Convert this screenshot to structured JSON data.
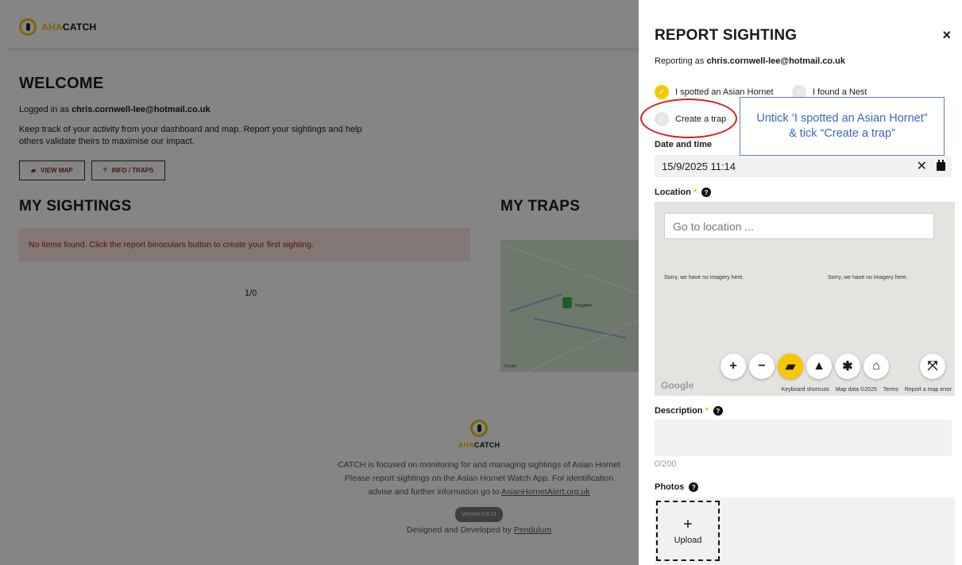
{
  "app": {
    "brand_aha": "AHA",
    "brand_catch": "CATCH"
  },
  "welcome": {
    "title": "WELCOME",
    "logged_prefix": "Logged in as ",
    "logged_email": "chris.cornwell-lee@hotmail.co.uk",
    "intro": "Keep track of your activity from your dashboard and map. Report your sightings and help others validate theirs to maximise our impact.",
    "view_map": "VIEW MAP",
    "info_traps": "INFO / TRAPS"
  },
  "sightings": {
    "title": "MY SIGHTINGS",
    "empty_message": "No items found. Click the report binoculars button to create your first sighting.",
    "pager": "1/0"
  },
  "traps": {
    "title": "MY TRAPS",
    "map_place": "Haughton",
    "map_attribution": "Google"
  },
  "footer": {
    "line1": "CATCH is focused on monitoring for and managing sightings of Asian Hornet",
    "line2": "Please report sightings on the Asian Hornet Watch App. For identification",
    "line3_prefix": "advise and further information go to ",
    "line3_link": "AsianHornetAlert.org.uk",
    "version": "Version 0.9.11",
    "designed_prefix": "Designed and Developed by ",
    "designed_link": "Pendulum"
  },
  "panel": {
    "title": "REPORT SIGHTING",
    "close": "×",
    "reporting_prefix": "Reporting as ",
    "reporting_email": "chris.cornwell-lee@hotmail.co.uk",
    "options": [
      {
        "label": "I spotted an Asian Hornet",
        "checked": true
      },
      {
        "label": "I found a Nest",
        "checked": false
      },
      {
        "label": "Create a trap",
        "checked": false
      }
    ],
    "datetime_label": "Date and time",
    "datetime_value": "15/9/2025 11:14",
    "location_label": "Location",
    "location_placeholder": "Go to location ...",
    "no_imagery": "Sorry, we have no imagery here.",
    "map_google": "Google",
    "map_footer": [
      "Keyboard shortcuts",
      "Map data ©2025",
      "Terms",
      "Report a map error"
    ],
    "description_label": "Description",
    "char_count": "0/200",
    "photos_label": "Photos",
    "upload_label": "Upload",
    "accent": "#f5c800"
  },
  "annotation": {
    "note": "Untick ‘I spotted an Asian Hornet” & tick “Create a trap”",
    "oval_color": "#d81e1e",
    "note_color": "#3a67b8"
  }
}
